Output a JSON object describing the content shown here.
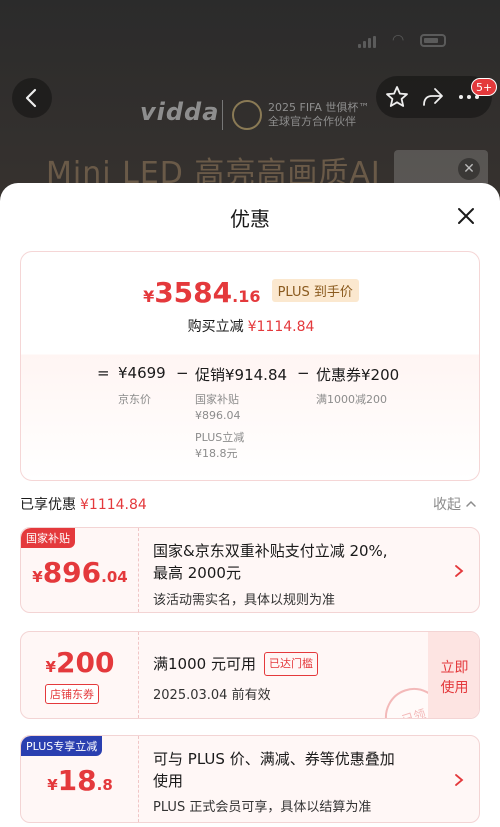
{
  "status_bar": {
    "time": "",
    "wifi_icon": "wifi-icon",
    "battery_icon": "battery-icon"
  },
  "top_nav": {
    "back_icon": "chevron-left-icon",
    "favorite_icon": "star-icon",
    "share_icon": "share-icon",
    "more_icon": "more-icon",
    "message_badge": "5+"
  },
  "banner": {
    "brand": "vidda",
    "fifa_line1": "2025 FIFA 世俱杯™",
    "fifa_line2": "全球官方合作伙伴",
    "headline": "Mini LED 高亮高画质AI"
  },
  "sheet": {
    "title": "优惠",
    "close_icon": "close-icon",
    "summary": {
      "final_price_symbol": "¥",
      "final_price_int": "3584",
      "final_price_dec": ".16",
      "plus_tag": "PLUS 到手价",
      "buy_reduce_label": "购买立减",
      "buy_reduce_value": "¥1114.84",
      "calc": {
        "eq": "=",
        "jd_price": "¥4699",
        "minus1": "−",
        "promo": "促销¥914.84",
        "minus2": "−",
        "coupon": "优惠券¥200",
        "jd_price_label": "京东价",
        "promo_item1_label": "国家补贴",
        "promo_item1_value": "¥896.04",
        "promo_item2_label": "PLUS立减",
        "promo_item2_value": "¥18.8元",
        "coupon_item_label": "满1000减200"
      }
    },
    "enjoyed_label": "已享优惠",
    "enjoyed_value": "¥1114.84",
    "collapse_label": "收起",
    "cards": [
      {
        "tag": "国家补贴",
        "tag_color": "#e4393c",
        "yen": "¥",
        "amount_int": "896",
        "amount_dec": ".04",
        "line1": "国家&京东双重补贴支付立减 20%,",
        "line2": "最高 2000元",
        "desc": "该活动需实名，具体以规则为准"
      },
      {
        "yen": "¥",
        "amount_int": "200",
        "sub_tag": "店铺东券",
        "line1": "满1000 元可用",
        "reached": "已达门槛",
        "desc": "2025.03.04 前有效",
        "use_btn_line1": "立即",
        "use_btn_line2": "使用",
        "stamp": "已领"
      },
      {
        "tag": "PLUS专享立减",
        "tag_color": "#2a3fb0",
        "yen": "¥",
        "amount_int": "18",
        "amount_dec": ".8",
        "line1": "可与 PLUS 价、满减、券等优惠叠加",
        "line2": "使用",
        "desc": "PLUS 正式会员可享，具体以结算为准"
      }
    ]
  }
}
